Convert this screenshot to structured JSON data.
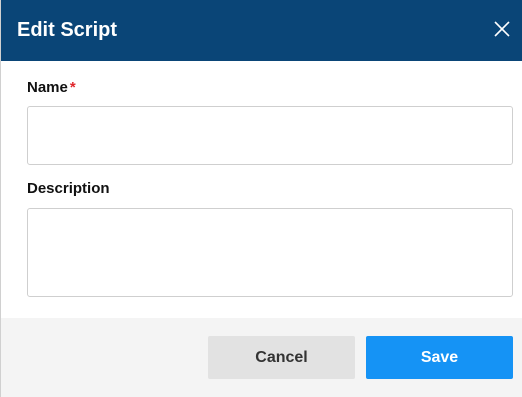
{
  "dialog": {
    "title": "Edit Script",
    "close_icon": "close-icon"
  },
  "form": {
    "name_label": "Name",
    "name_required_marker": "*",
    "name_value": "",
    "description_label": "Description",
    "description_value": ""
  },
  "footer": {
    "cancel_label": "Cancel",
    "save_label": "Save"
  },
  "colors": {
    "titlebar": "#0a4577",
    "save_button": "#1593f5",
    "cancel_button": "#e2e2e2",
    "required_marker": "#e0262b",
    "footer_background": "#f4f4f4"
  }
}
